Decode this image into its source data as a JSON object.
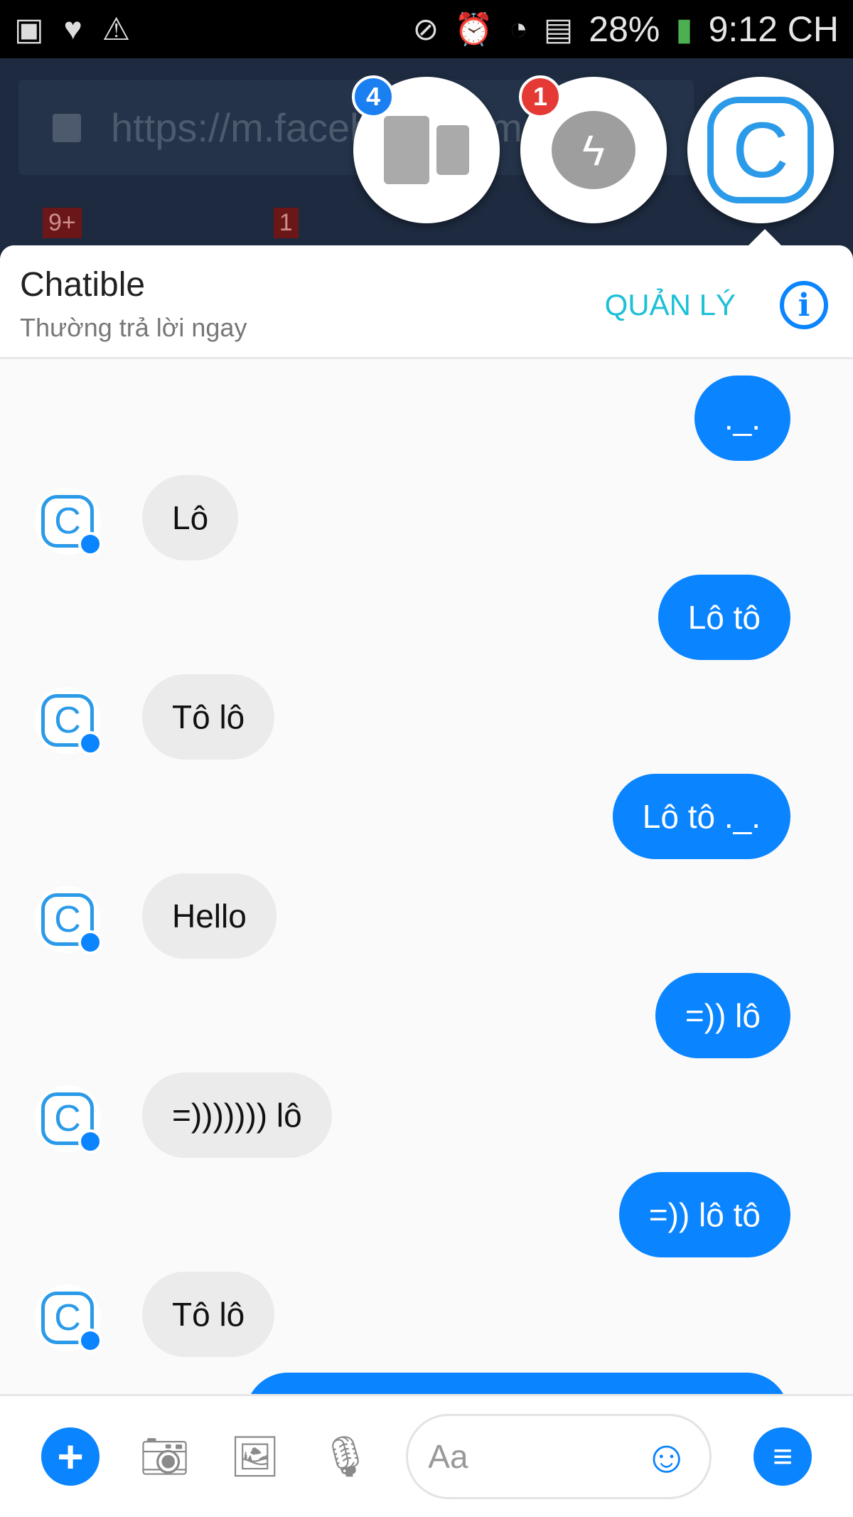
{
  "status_bar": {
    "battery": "28%",
    "time": "9:12 CH",
    "icons": [
      "app-icon",
      "heart-icon",
      "warning-icon",
      "mute-icon",
      "alarm-icon",
      "wifi-icon",
      "sd-card-icon",
      "battery-charging-icon"
    ]
  },
  "browser": {
    "url": "https://m.facebook.com",
    "tab_badges": [
      "9+",
      "1"
    ]
  },
  "chat_heads": [
    {
      "icon": "tabs-icon",
      "badge": "4",
      "badge_color": "#1a7ff0"
    },
    {
      "icon": "messenger-icon",
      "badge": "1",
      "badge_color": "#e53935"
    },
    {
      "icon": "chatible-logo"
    }
  ],
  "header": {
    "title": "Chatible",
    "subtitle": "Thường trả lời ngay",
    "manage": "QUẢN LÝ",
    "info_icon": "i"
  },
  "messages": [
    {
      "from": "me",
      "text": "._."
    },
    {
      "from": "them",
      "text": "Lô"
    },
    {
      "from": "me",
      "text": "Lô tô"
    },
    {
      "from": "them",
      "text": "Tô lô"
    },
    {
      "from": "me",
      "text": "Lô tô ._."
    },
    {
      "from": "them",
      "text": "Hello"
    },
    {
      "from": "me",
      "text": "=)) lô"
    },
    {
      "from": "them",
      "text": "=))))))) lô"
    },
    {
      "from": "me",
      "text": "=)) lô tô"
    },
    {
      "from": "them",
      "text": "Tô lô"
    }
  ],
  "composer": {
    "placeholder": "Aa"
  },
  "colors": {
    "accent": "#0a84ff",
    "manage": "#1ec0d6"
  }
}
